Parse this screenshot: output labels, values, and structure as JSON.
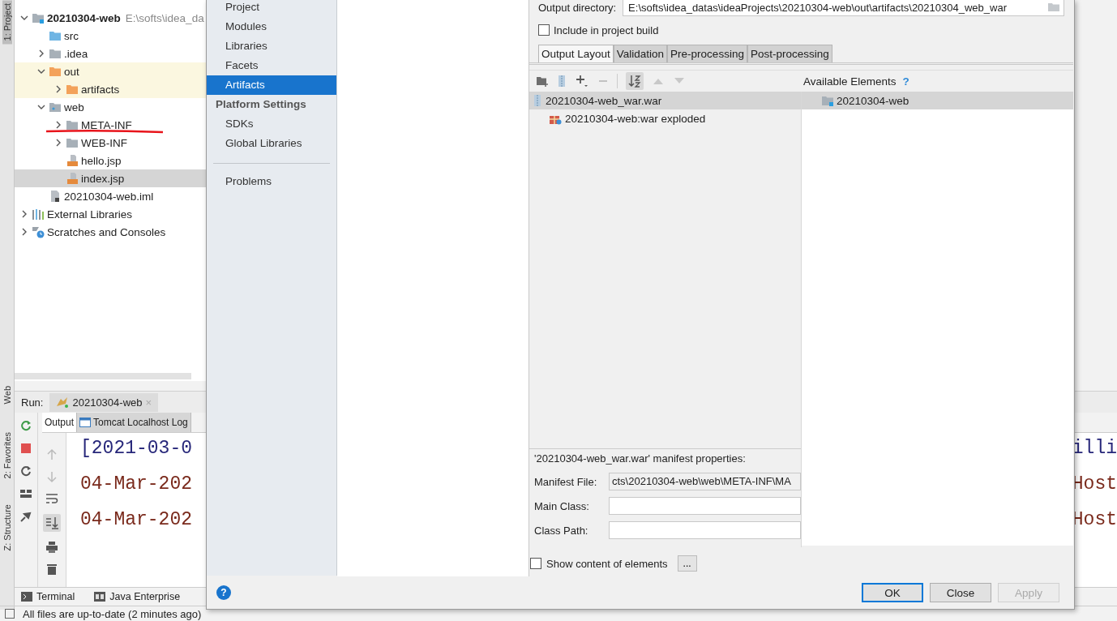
{
  "tool_strip": [
    {
      "label": "1: Project",
      "selected": true
    },
    {
      "label": "Web",
      "selected": false
    },
    {
      "label": "2: Favorites",
      "selected": false
    },
    {
      "label": "Z: Structure",
      "selected": false
    }
  ],
  "project_tree": [
    {
      "name": "20210304-web",
      "path": "E:\\softs\\idea_da",
      "kind": "module",
      "expanded": true,
      "selected": false,
      "excluded": false,
      "children": [
        {
          "name": "src",
          "kind": "source",
          "selected": false,
          "excluded": false
        },
        {
          "name": ".idea",
          "kind": "folder",
          "expanded": false,
          "selected": false,
          "excluded": false
        },
        {
          "name": "out",
          "kind": "folder",
          "expanded": true,
          "selected": false,
          "excluded": true,
          "children": [
            {
              "name": "artifacts",
              "kind": "folder",
              "expanded": false,
              "selected": false,
              "excluded": true
            }
          ]
        },
        {
          "name": "web",
          "kind": "web",
          "expanded": true,
          "selected": false,
          "excluded": false,
          "children": [
            {
              "name": "META-INF",
              "kind": "folder",
              "expanded": false,
              "selected": false,
              "excluded": false
            },
            {
              "name": "WEB-INF",
              "kind": "folder",
              "expanded": false,
              "selected": false,
              "excluded": false
            },
            {
              "name": "hello.jsp",
              "kind": "jsp",
              "selected": false,
              "excluded": false
            },
            {
              "name": "index.jsp",
              "kind": "jsp",
              "selected": true,
              "excluded": false
            }
          ]
        },
        {
          "name": "20210304-web.iml",
          "kind": "iml",
          "selected": false,
          "excluded": false
        }
      ]
    },
    {
      "name": "External Libraries",
      "kind": "libraries",
      "expanded": false,
      "selected": false,
      "excluded": false
    },
    {
      "name": "Scratches and Consoles",
      "kind": "scratches",
      "expanded": false,
      "selected": false,
      "excluded": false
    }
  ],
  "run": {
    "label": "Run:",
    "tab": {
      "label": "20210304-web",
      "close": "×"
    },
    "output_tabs": [
      {
        "label": "Output",
        "selected": true
      },
      {
        "label": "Tomcat Localhost Log",
        "selected": false
      }
    ],
    "console": [
      {
        "kind": "stdout",
        "left": "[2021-03-0",
        "right": "illi"
      },
      {
        "kind": "stderr",
        "left": "04-Mar-202",
        "right": "Host"
      },
      {
        "kind": "stderr",
        "left": "04-Mar-202",
        "right": "Host"
      }
    ]
  },
  "bottom_tabs": [
    {
      "label": "Terminal",
      "kind": "terminal"
    },
    {
      "label": "Java Enterprise",
      "kind": "enterprise"
    }
  ],
  "status_bar": "All files are up-to-date (2 minutes ago)",
  "dialog": {
    "nav": [
      {
        "kind": "item",
        "label": "Project",
        "selected": false
      },
      {
        "kind": "item",
        "label": "Modules",
        "selected": false
      },
      {
        "kind": "item",
        "label": "Libraries",
        "selected": false
      },
      {
        "kind": "item",
        "label": "Facets",
        "selected": false
      },
      {
        "kind": "item",
        "label": "Artifacts",
        "selected": true
      },
      {
        "kind": "header",
        "label": "Platform Settings"
      },
      {
        "kind": "item",
        "label": "SDKs",
        "selected": false
      },
      {
        "kind": "item",
        "label": "Global Libraries",
        "selected": false
      },
      {
        "kind": "separator"
      },
      {
        "kind": "item",
        "label": "Problems",
        "selected": false
      }
    ],
    "output_directory": {
      "label": "Output directory:",
      "value": "E:\\softs\\idea_datas\\ideaProjects\\20210304-web\\out\\artifacts\\20210304_web_war"
    },
    "include_in_build": {
      "label": "Include in project build",
      "checked": false
    },
    "tabs": [
      {
        "label": "Output Layout",
        "selected": true
      },
      {
        "label": "Validation",
        "selected": false
      },
      {
        "label": "Pre-processing",
        "selected": false
      },
      {
        "label": "Post-processing",
        "selected": false
      }
    ],
    "layout_tree": [
      {
        "name": "20210304-web_war.war",
        "kind": "archive",
        "selected": true,
        "children": [
          {
            "name": "20210304-web:war exploded",
            "kind": "artifact",
            "selected": false
          }
        ]
      }
    ],
    "available": {
      "title": "Available Elements",
      "help": "?",
      "items": [
        {
          "name": "20210304-web",
          "kind": "module",
          "selected": true
        }
      ]
    },
    "manifest": {
      "title": "'20210304-web_war.war' manifest properties:",
      "fields": [
        {
          "label": "Manifest File:",
          "value": "cts\\20210304-web\\web\\META-INF\\MA"
        },
        {
          "label": "Main Class:"
        },
        {
          "label": "Class Path:"
        }
      ]
    },
    "show_content": {
      "label": "Show content of elements",
      "checked": false,
      "button": "..."
    },
    "help": "?",
    "buttons": [
      {
        "label": "OK",
        "default": true,
        "disabled": false
      },
      {
        "label": "Close",
        "default": false,
        "disabled": false
      },
      {
        "label": "Apply",
        "default": false,
        "disabled": true
      }
    ]
  }
}
